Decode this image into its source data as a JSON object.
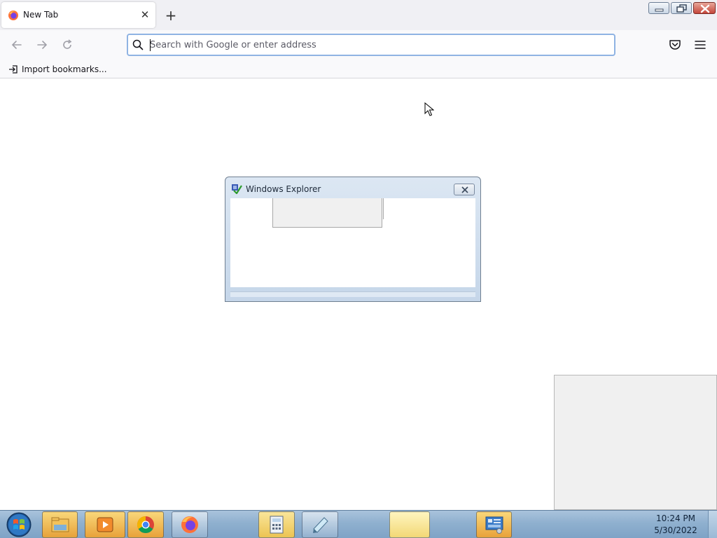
{
  "browser": {
    "tab": {
      "title": "New Tab",
      "favicon": "firefox-icon"
    },
    "new_tab_label": "+",
    "url_bar": {
      "placeholder": "Search with Google or enter address",
      "value": ""
    },
    "bookmarks": [
      {
        "label": "Import bookmarks...",
        "icon": "import-icon"
      }
    ]
  },
  "dialog": {
    "title": "Windows Explorer",
    "icon": "explorer-check-icon"
  },
  "taskbar": {
    "start_icon": "windows-start-icon",
    "apps": [
      {
        "name": "explorer",
        "icon": "folder-icon",
        "active": true
      },
      {
        "name": "media-player",
        "icon": "media-player-icon",
        "active": true
      },
      {
        "name": "chrome",
        "icon": "chrome-icon",
        "active": true
      },
      {
        "name": "firefox",
        "icon": "firefox-icon",
        "active": false
      },
      {
        "name": "calculator",
        "icon": "calculator-icon",
        "active": true
      },
      {
        "name": "notepad",
        "icon": "notepad-icon",
        "active": false
      },
      {
        "name": "blank-window",
        "icon": "",
        "active": true
      },
      {
        "name": "control-panel",
        "icon": "control-panel-icon",
        "active": true
      }
    ],
    "clock": {
      "time": "10:24 PM",
      "date": "5/30/2022"
    }
  },
  "colors": {
    "accent": "#8fb3e3",
    "taskbar": "#8fb0cf",
    "active_task": "#e8a23a"
  }
}
